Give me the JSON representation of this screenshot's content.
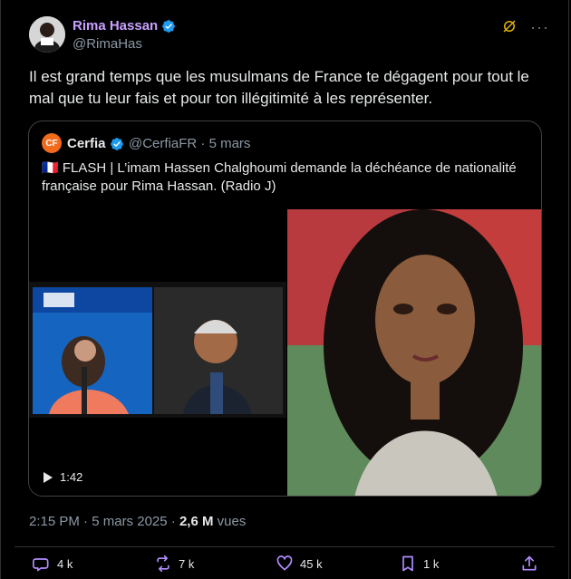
{
  "author": {
    "name": "Rima Hassan",
    "handle": "@RimaHas"
  },
  "tweet": {
    "text": "Il est grand temps que les musulmans de France te dégagent pour tout le mal que tu leur fais et pour ton illégitimité à les représenter."
  },
  "quote": {
    "name": "Cerfia",
    "meta": "@CerfiaFR · 5 mars",
    "text": "🇫🇷 FLASH | L’imam Hassen Chalghoumi demande la déchéance de nationalité française pour Rima Hassan. (Radio J)",
    "video_duration": "1:42",
    "logo_text": "CF"
  },
  "meta": {
    "time": "2:15 PM",
    "date": "5 mars 2025",
    "views_count": "2,6 M",
    "views_label": "vues"
  },
  "actions": {
    "replies": "4 k",
    "reposts": "7 k",
    "likes": "45 k",
    "bookmarks": "1 k"
  },
  "colors": {
    "background": "#000000",
    "name": "#c9a0ff",
    "muted": "#8b98a5",
    "text": "#e7e9ea",
    "verified": "#1d9bf0",
    "border": "#2f3336",
    "actions": "#b28cff"
  },
  "icons": [
    "grok-icon",
    "more-icon",
    "verified-icon",
    "reply-icon",
    "repost-icon",
    "like-icon",
    "bookmark-icon",
    "share-icon",
    "play-icon"
  ]
}
